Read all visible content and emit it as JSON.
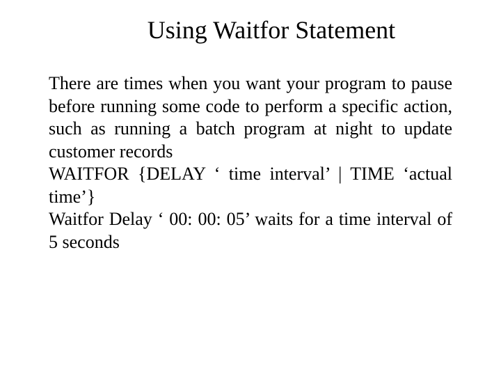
{
  "title": "Using Waitfor Statement",
  "para1": "There are times when you want your program to pause before running some code to perform a specific action, such as running a batch program at  night to update customer records",
  "para2": "WAITFOR {DELAY ‘ time interval’ | TIME ‘actual time’}",
  "para3": "Waitfor Delay ‘ 00: 00: 05’ waits for a time interval of 5 seconds"
}
